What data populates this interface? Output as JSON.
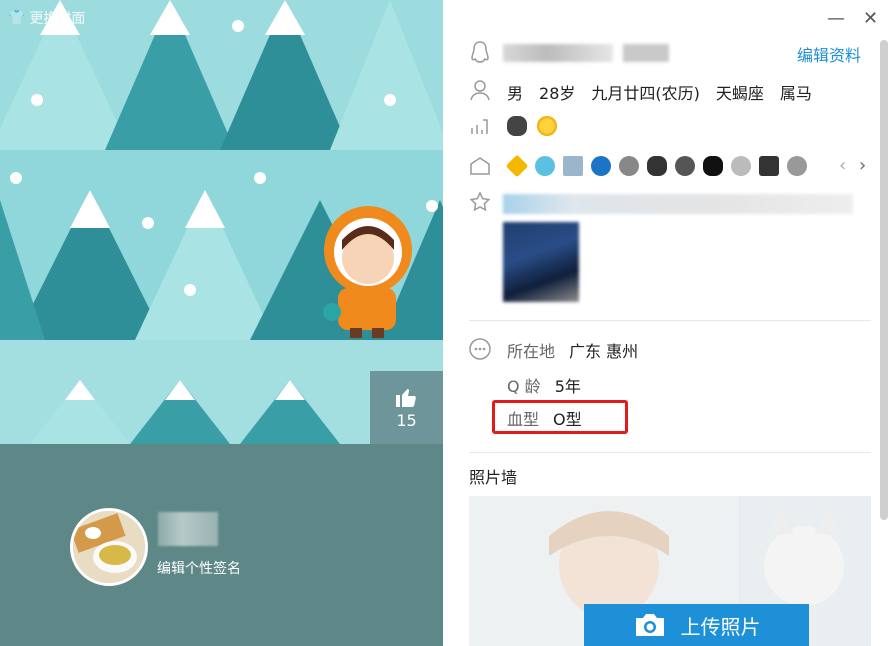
{
  "cover": {
    "change_cover_label": "更换封面",
    "like_count": "15"
  },
  "profile": {
    "signature_prompt": "编辑个性签名",
    "edit_profile": "编辑资料",
    "basic_info": [
      "男",
      "28岁",
      "九月廿四(农历)",
      "天蝎座",
      "属马"
    ]
  },
  "details": {
    "location": {
      "label": "所在地",
      "value": "广东 惠州"
    },
    "qage": {
      "label": "Q 龄",
      "value": "5年"
    },
    "blood": {
      "label": "血型",
      "value": "O型"
    }
  },
  "photos": {
    "title": "照片墙",
    "upload_label": "上传照片"
  },
  "colors": {
    "link": "#1c8fd8",
    "highlight": "#e21a1a",
    "cover_bottom": "#5d8887",
    "upload": "#1e90d8"
  }
}
